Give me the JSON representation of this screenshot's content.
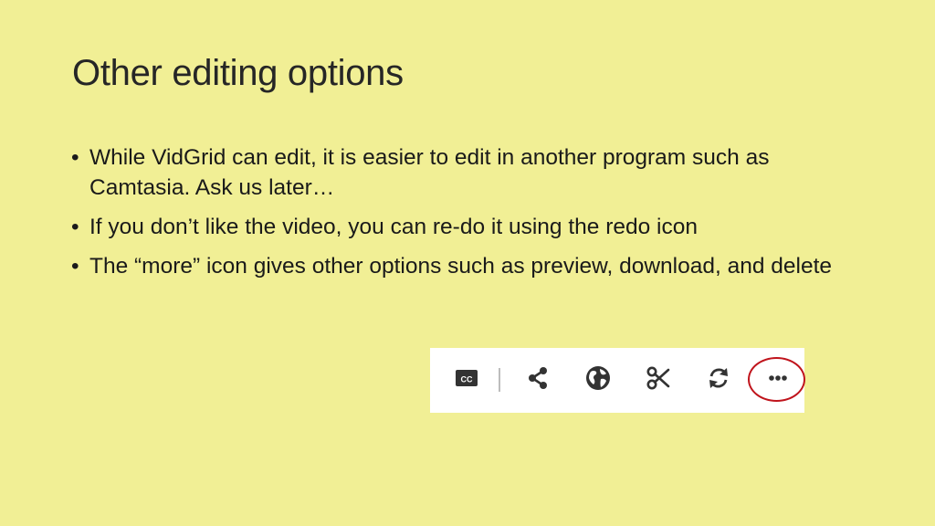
{
  "slide": {
    "title": "Other editing options",
    "bullets": [
      {
        "text": "While VidGrid can edit, it is easier to edit in another program such as Camtasia.  Ask us later…"
      },
      {
        "text": "If you don’t like the video, you can re-do it using the redo icon"
      },
      {
        "text": "The “more” icon gives other options such as preview, download, and delete"
      }
    ],
    "bullet_glyph": "•"
  },
  "toolbar": {
    "icons": [
      "closed-captions-icon",
      "share-icon",
      "globe-icon",
      "scissors-icon",
      "redo-icon",
      "more-icon"
    ],
    "highlighted": "more-icon"
  },
  "colors": {
    "background": "#f1ef95",
    "toolbar_background": "#ffffff",
    "icon": "#333333",
    "highlight_ring": "#c0141c"
  }
}
